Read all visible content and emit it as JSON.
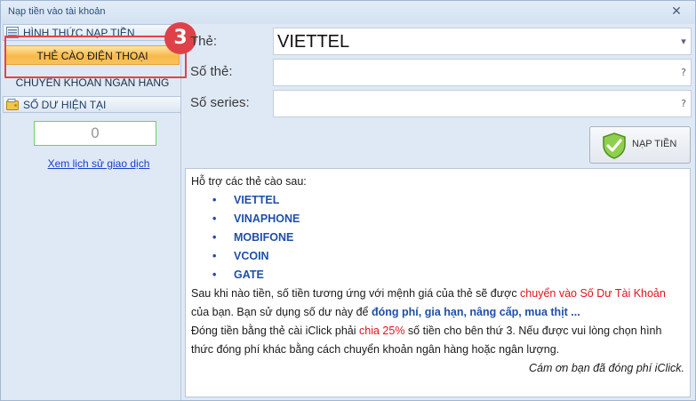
{
  "window": {
    "title": "Nạp tiền vào tài khoản",
    "close_glyph": "✕"
  },
  "sidebar": {
    "section_method": "HÌNH THỨC NẠP TIỀN",
    "items": [
      {
        "label": "THẺ CÀO ĐIỆN THOẠI",
        "active": true
      },
      {
        "label": "CHUYỂN KHOẢN NGÂN HÀNG",
        "active": false
      }
    ],
    "section_balance": "SỐ DƯ HIỆN TẠI",
    "balance_value": "0",
    "history_link": "Xem lịch sử giao dịch",
    "step_badge": "3"
  },
  "form": {
    "card_label": "Thẻ:",
    "card_value": "VIETTEL",
    "card_number_label": "Số thẻ:",
    "card_number_value": "",
    "series_label": "Số series:",
    "series_value": "",
    "dropdown_glyph": "▾",
    "help_glyph": "?",
    "submit_label": "NẠP TIỀN"
  },
  "info": {
    "intro": "Hỗ trợ các thẻ cào sau:",
    "carriers": [
      "VIETTEL",
      "VINAPHONE",
      "MOBIFONE",
      "VCOIN",
      "GATE"
    ],
    "bullet": "•",
    "p1_a": "Sau khi nào tiền, số tiền tương ứng với mệnh giá của thẻ sẽ được ",
    "p1_red": "chuyển vào Số Dư Tài Khoản",
    "p1_b": " của bạn. Bạn sử dụng số dư này để ",
    "p1_blue": "đóng phí, gia hạn, nâng cấp, mua thịt ...",
    "p2_a": "Đóng tiền bằng thẻ cài iClick phải ",
    "p2_red": "chia 25%",
    "p2_b": " số tiền cho bên thứ 3. Nếu được vui lòng chọn hình thức đóng phí khác bằng cách chuyển khoản ngân hàng hoặc ngân lượng.",
    "thanks": "Cám ơn bạn đã đóng phí iClick."
  },
  "colors": {
    "accent_orange": "#f8b94a",
    "badge_red": "#df4149",
    "link_blue": "#1840c8",
    "highlight_red": "#e4121b",
    "bold_blue": "#1f4fa8"
  }
}
